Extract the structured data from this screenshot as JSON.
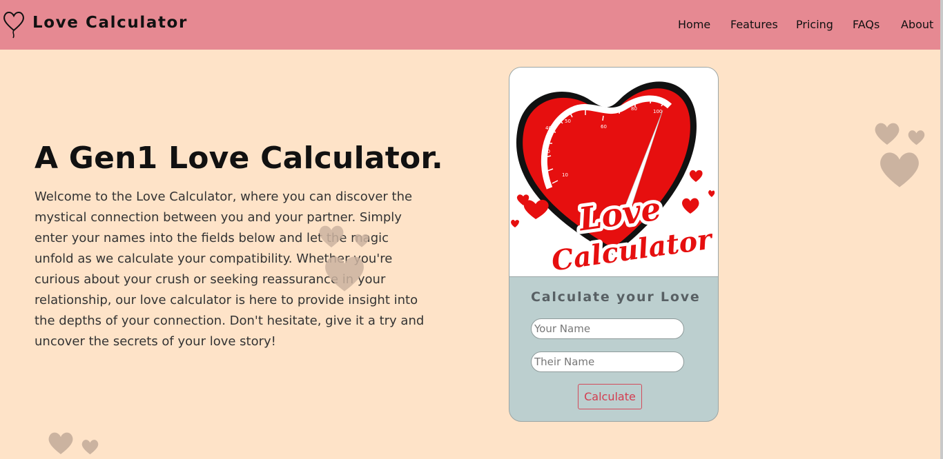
{
  "brand": {
    "name": "Love Calculator",
    "icon": "heart-balloon-icon"
  },
  "nav": {
    "items": [
      {
        "label": "Home"
      },
      {
        "label": "Features"
      },
      {
        "label": "Pricing"
      },
      {
        "label": "FAQs"
      },
      {
        "label": "About"
      }
    ]
  },
  "hero": {
    "title": "A Gen1 Love Calculator.",
    "description": "Welcome to the Love Calculator, where you can discover the mystical connection between you and your partner. Simply enter your names into the fields below and let the magic unfold as we calculate your compatibility. Whether you're curious about your crush or seeking reassurance in your relationship, our love calculator is here to provide insight into the depths of your connection. Don't hesitate, give it a try and uncover the secrets of your love story!"
  },
  "card": {
    "image": {
      "icon": "love-meter-heart-image",
      "logo_line1": "Love",
      "logo_line2": "Calculator",
      "gauge_ticks": [
        "10",
        "30",
        "40",
        "50",
        "60",
        "80",
        "100"
      ],
      "needle_value": 100
    },
    "title": "Calculate your Love",
    "your_name_placeholder": "Your Name",
    "their_name_placeholder": "Their Name",
    "button_label": "Calculate"
  },
  "colors": {
    "navbar": "#e68992",
    "background": "#fee3c8",
    "card_panel": "#bccfcf",
    "decorative_heart": "#cbb3a0",
    "button_accent": "#d33c4f"
  }
}
